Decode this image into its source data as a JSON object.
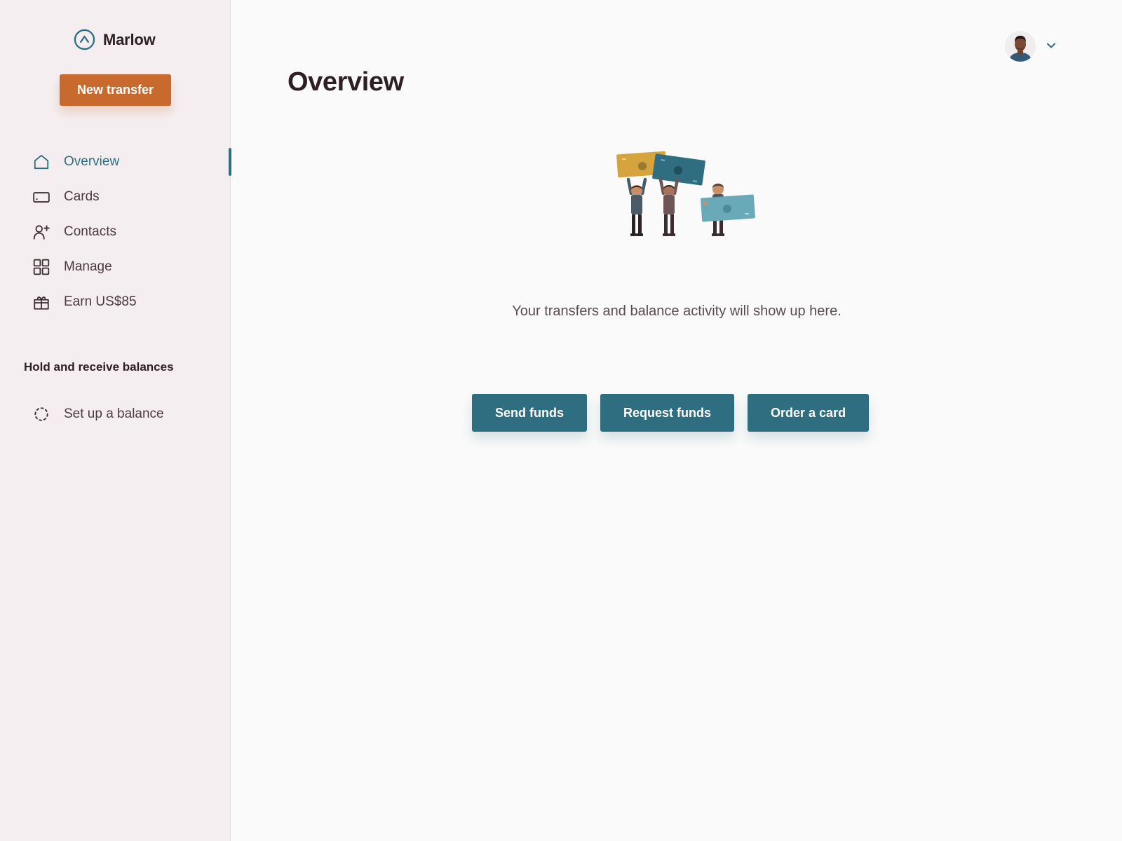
{
  "brand": {
    "name": "Marlow",
    "icon": "marlow-logo-icon"
  },
  "sidebar": {
    "new_transfer_label": "New transfer",
    "items": [
      {
        "label": "Overview",
        "icon": "home-icon",
        "active": true
      },
      {
        "label": "Cards",
        "icon": "card-icon",
        "active": false
      },
      {
        "label": "Contacts",
        "icon": "add-contact-icon",
        "active": false
      },
      {
        "label": "Manage",
        "icon": "grid-icon",
        "active": false
      },
      {
        "label": "Earn US$85",
        "icon": "gift-icon",
        "active": false
      }
    ],
    "section_heading": "Hold and receive balances",
    "balance_item": {
      "label": "Set up a balance",
      "icon": "dashed-circle-icon"
    }
  },
  "header": {
    "title": "Overview",
    "avatar_icon": "user-avatar",
    "menu_icon": "chevron-down-icon"
  },
  "main": {
    "illustration": "people-holding-money-illustration",
    "empty_message": "Your transfers and balance activity will show up here.",
    "actions": [
      {
        "label": "Send funds"
      },
      {
        "label": "Request funds"
      },
      {
        "label": "Order a card"
      }
    ]
  },
  "colors": {
    "primary": "#2e6e80",
    "accent": "#c8692e",
    "sidebar_bg": "#f5eef0",
    "page_bg": "#fafafa"
  }
}
